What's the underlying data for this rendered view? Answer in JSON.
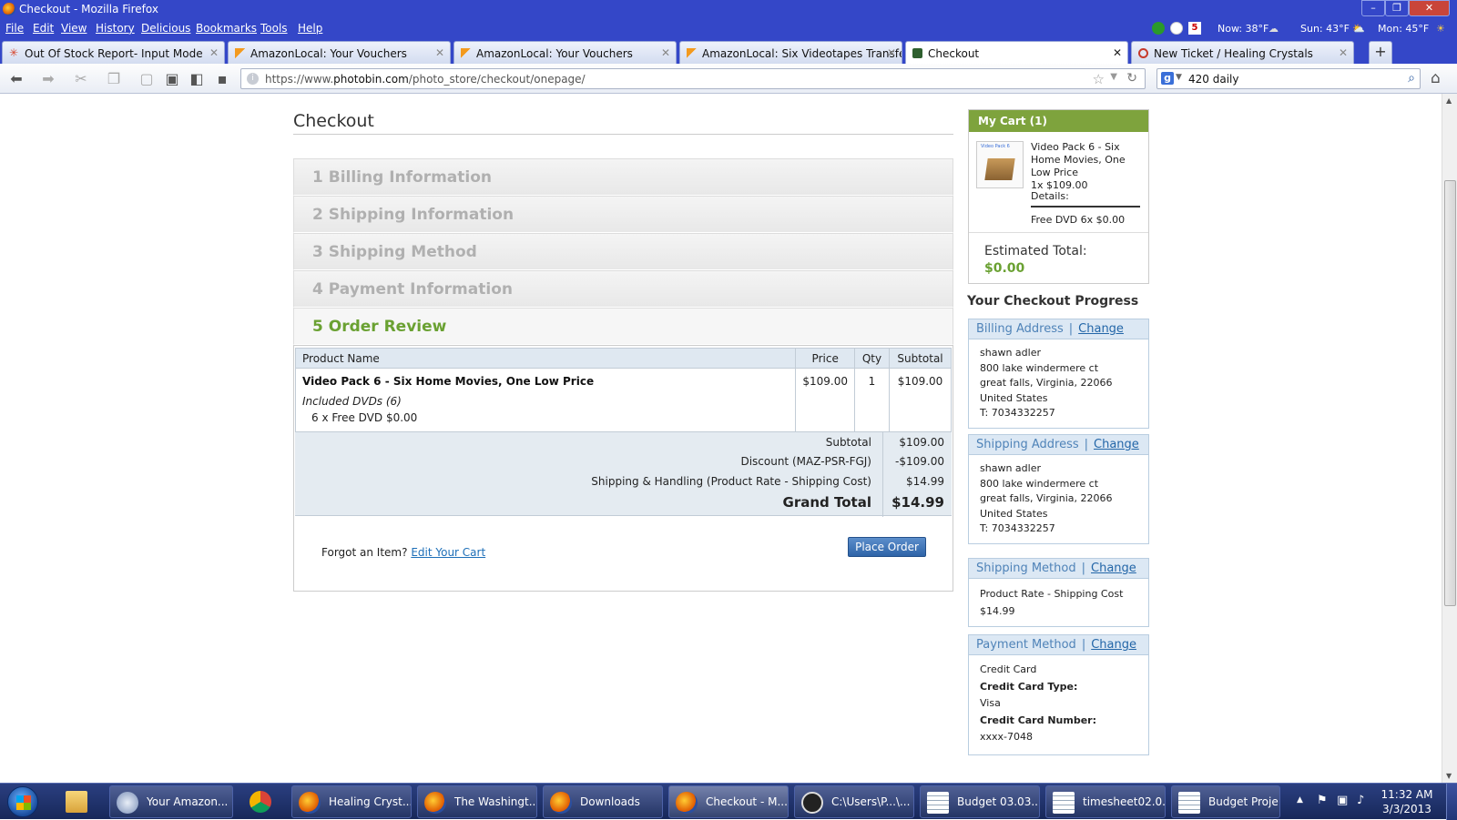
{
  "window": {
    "title": "Checkout - Mozilla Firefox",
    "controls": [
      "–",
      "❐",
      "✕"
    ]
  },
  "menu": [
    "File",
    "Edit",
    "View",
    "History",
    "Delicious",
    "Bookmarks",
    "Tools",
    "Help"
  ],
  "status": {
    "now": "Now: 38°F",
    "sun": "Sun: 43°F",
    "mon": "Mon: 45°F",
    "calendar_day": "5"
  },
  "tabs": [
    {
      "label": "Out Of Stock Report- Input Mode",
      "icon": "asterisk-icon"
    },
    {
      "label": "AmazonLocal: Your Vouchers",
      "icon": "flag-icon"
    },
    {
      "label": "AmazonLocal: Your Vouchers",
      "icon": "flag-icon"
    },
    {
      "label": "AmazonLocal: Six Videotapes Transfe...",
      "icon": "flag-icon"
    },
    {
      "label": "Checkout",
      "icon": "photobin-icon",
      "active": true
    },
    {
      "label": "New Ticket / Healing Crystals",
      "icon": "oc-icon"
    }
  ],
  "nav": {
    "url_prefix": "https://www.",
    "url_domain": "photobin.com",
    "url_path": "/photo_store/checkout/onepage/",
    "search_query": "420 daily",
    "search_engine": "g"
  },
  "page": {
    "title": "Checkout",
    "steps": [
      {
        "label": "1 Billing Information"
      },
      {
        "label": "2 Shipping Information"
      },
      {
        "label": "3 Shipping Method"
      },
      {
        "label": "4 Payment Information"
      },
      {
        "label": "5 Order Review",
        "active": true
      }
    ],
    "order": {
      "headers": {
        "product": "Product Name",
        "price": "Price",
        "qty": "Qty",
        "subtotal": "Subtotal"
      },
      "item": {
        "name": "Video Pack 6 - Six Home Movies, One Low Price",
        "included": "Included DVDs (6)",
        "included_detail": "6 x Free DVD $0.00",
        "price": "$109.00",
        "qty": "1",
        "subtotal": "$109.00"
      },
      "totals": {
        "subtotal_label": "Subtotal",
        "subtotal": "$109.00",
        "discount_label": "Discount (MAZ-PSR-FGJ)",
        "discount": "-$109.00",
        "shipping_label": "Shipping & Handling (Product Rate - Shipping Cost)",
        "shipping": "$14.99",
        "grand_label": "Grand Total",
        "grand": "$14.99"
      },
      "forgot_text": "Forgot an Item?",
      "edit_cart": "Edit Your Cart",
      "place_order": "Place Order"
    }
  },
  "sidebar": {
    "cart_title": "My Cart (1)",
    "thumb_text": "Video Pack 6",
    "cart_item": "Video Pack 6 - Six Home Movies, One Low Price",
    "cart_item_price": "1x $109.00",
    "details_label": "Details:",
    "details_value": "Free DVD 6x $0.00",
    "est_label": "Estimated Total:",
    "est_value": "$0.00",
    "progress_title": "Your Checkout Progress",
    "change": "Change",
    "billing": {
      "title": "Billing Address",
      "name": "shawn adler",
      "street": "800 lake windermere ct",
      "city": "great falls, Virginia, 22066",
      "country": "United States",
      "phone": "T: 7034332257"
    },
    "shipping": {
      "title": "Shipping Address",
      "name": "shawn adler",
      "street": "800 lake windermere ct",
      "city": "great falls, Virginia, 22066",
      "country": "United States",
      "phone": "T: 7034332257"
    },
    "method": {
      "title": "Shipping Method",
      "name": "Product Rate - Shipping Cost",
      "price": "$14.99"
    },
    "payment": {
      "title": "Payment Method",
      "type": "Credit Card",
      "type_label": "Credit Card Type:",
      "type_value": "Visa",
      "number_label": "Credit Card Number:",
      "number_value": "xxxx-7048"
    }
  },
  "taskbar": {
    "items": [
      {
        "label": "Your Amazon...",
        "icon": "messenger-icon"
      },
      {
        "label": "",
        "icon": "chrome-icon"
      },
      {
        "label": "Healing Cryst...",
        "icon": "firefox-icon"
      },
      {
        "label": "The Washingt...",
        "icon": "firefox-icon"
      },
      {
        "label": "Downloads",
        "icon": "firefox-icon"
      },
      {
        "label": "Checkout - M...",
        "icon": "firefox-icon",
        "active": true
      },
      {
        "label": "C:\\Users\\P...\\...",
        "icon": "lock-icon"
      },
      {
        "label": "Budget 03.03....",
        "icon": "spreadsheet-icon"
      },
      {
        "label": "timesheet02.0...",
        "icon": "spreadsheet-icon"
      },
      {
        "label": "Budget Proje...",
        "icon": "spreadsheet-icon"
      }
    ],
    "time": "11:32 AM",
    "date": "3/3/2013"
  }
}
